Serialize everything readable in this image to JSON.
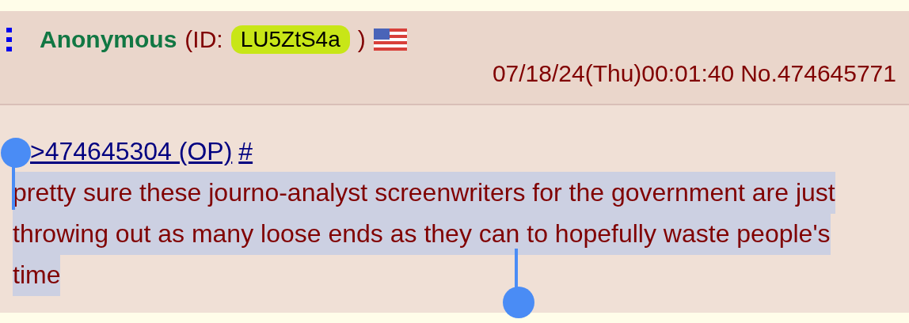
{
  "post": {
    "name": "Anonymous",
    "id_open": "(ID:",
    "poster_id": "LU5ZtS4a",
    "id_close": ")",
    "datetime": "07/18/24(Thu)00:01:40",
    "number": "No.474645771",
    "quote_link": ">474645304 (OP)",
    "anchor_link": "#",
    "comment": "pretty sure these journo-analyst screenwriters for the government are just throwing out as many loose ends as they can to hopefully waste people's time",
    "comment_selected": true
  }
}
